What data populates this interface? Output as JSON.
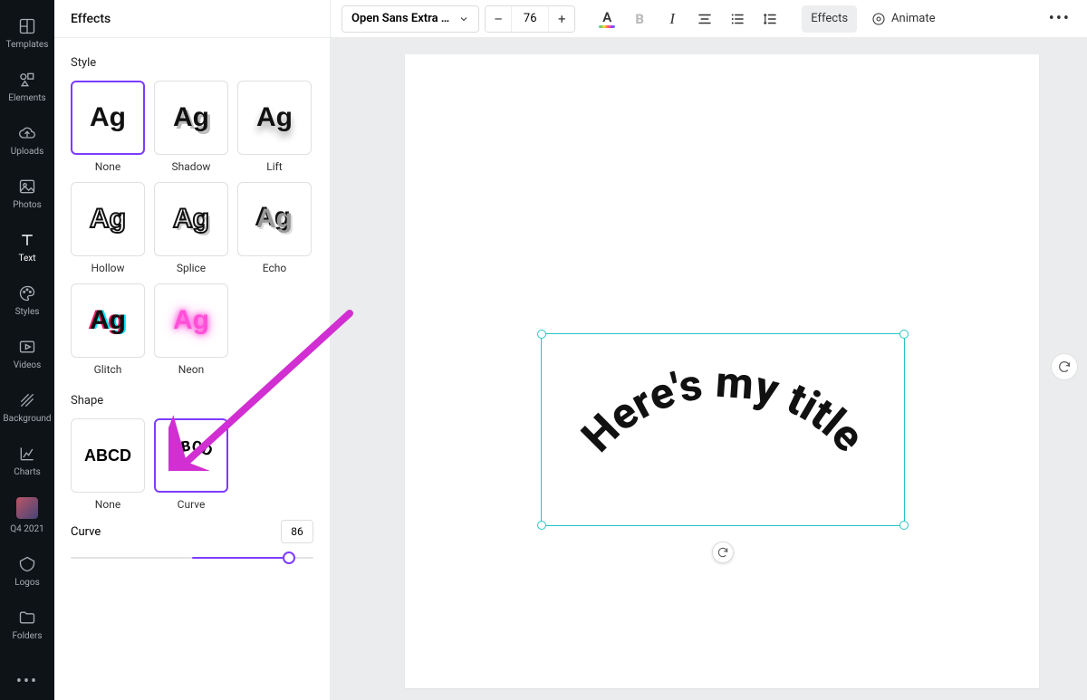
{
  "rail": {
    "items": [
      {
        "label": "Templates"
      },
      {
        "label": "Elements"
      },
      {
        "label": "Uploads"
      },
      {
        "label": "Photos"
      },
      {
        "label": "Text"
      },
      {
        "label": "Styles"
      },
      {
        "label": "Videos"
      },
      {
        "label": "Background"
      },
      {
        "label": "Charts"
      },
      {
        "label": "Q4 2021"
      },
      {
        "label": "Logos"
      },
      {
        "label": "Folders"
      }
    ]
  },
  "panel": {
    "title": "Effects",
    "style_label": "Style",
    "styles": [
      {
        "label": "None"
      },
      {
        "label": "Shadow"
      },
      {
        "label": "Lift"
      },
      {
        "label": "Hollow"
      },
      {
        "label": "Splice"
      },
      {
        "label": "Echo"
      },
      {
        "label": "Glitch"
      },
      {
        "label": "Neon"
      }
    ],
    "shape_label": "Shape",
    "shapes": [
      {
        "label": "None",
        "sample": "ABCD"
      },
      {
        "label": "Curve",
        "sample": "ABCD"
      }
    ],
    "curve_label": "Curve",
    "curve_value": "86"
  },
  "toolbar": {
    "font_name": "Open Sans Extra …",
    "font_size": "76",
    "effects_label": "Effects",
    "animate_label": "Animate"
  },
  "canvas": {
    "text": "Here's my title"
  }
}
